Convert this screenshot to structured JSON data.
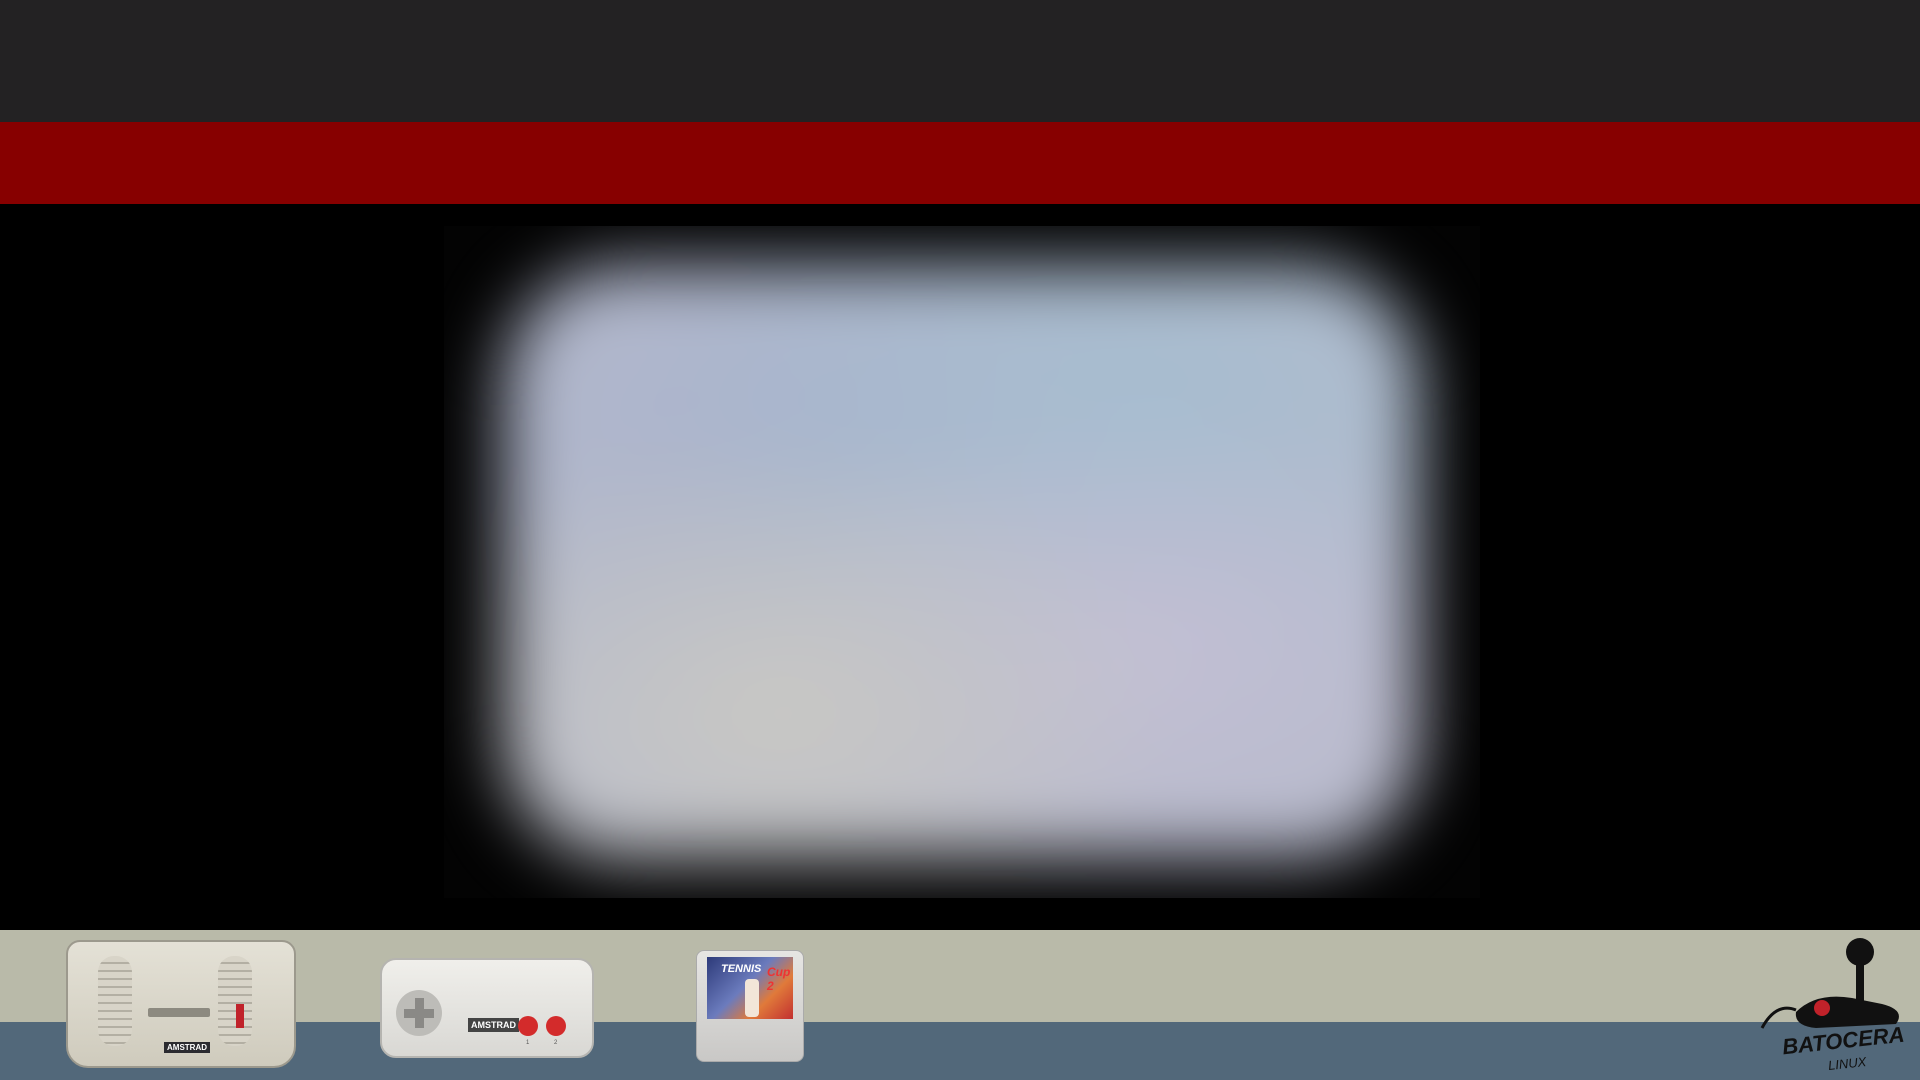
{
  "console": {
    "brand_label": "AMSTRAD"
  },
  "controller": {
    "brand_label": "AMSTRAD",
    "button_1_label": "1",
    "button_2_label": "2"
  },
  "cartridge": {
    "title_text": "TENNIS",
    "subtitle_text": "Cup 2"
  },
  "logo": {
    "name": "BATOCERA",
    "sub": "LINUX"
  },
  "colors": {
    "top_band": "#232223",
    "accent_band": "#870000",
    "bottom_cream": "#b9baa9",
    "bottom_slate": "#52687a"
  }
}
